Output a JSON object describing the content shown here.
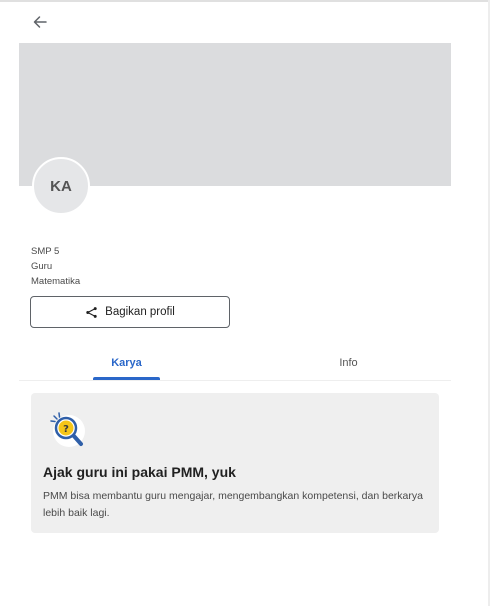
{
  "header": {
    "back_icon": "arrow-left-icon"
  },
  "profile": {
    "initials": "KA",
    "school": "SMP 5",
    "role": "Guru",
    "subject": "Matematika",
    "share_label": "Bagikan profil",
    "share_icon": "share-icon"
  },
  "tabs": [
    {
      "label": "Karya",
      "active": true
    },
    {
      "label": "Info",
      "active": false
    }
  ],
  "card": {
    "icon": "magnifier-question-icon",
    "title": "Ajak guru ini pakai PMM, yuk",
    "description": "PMM bisa membantu guru mengajar, mengembangkan kompetensi, dan berkarya lebih baik lagi."
  },
  "colors": {
    "accent": "#2a67c9",
    "cover": "#dbdcde",
    "card_bg": "#efefef"
  }
}
